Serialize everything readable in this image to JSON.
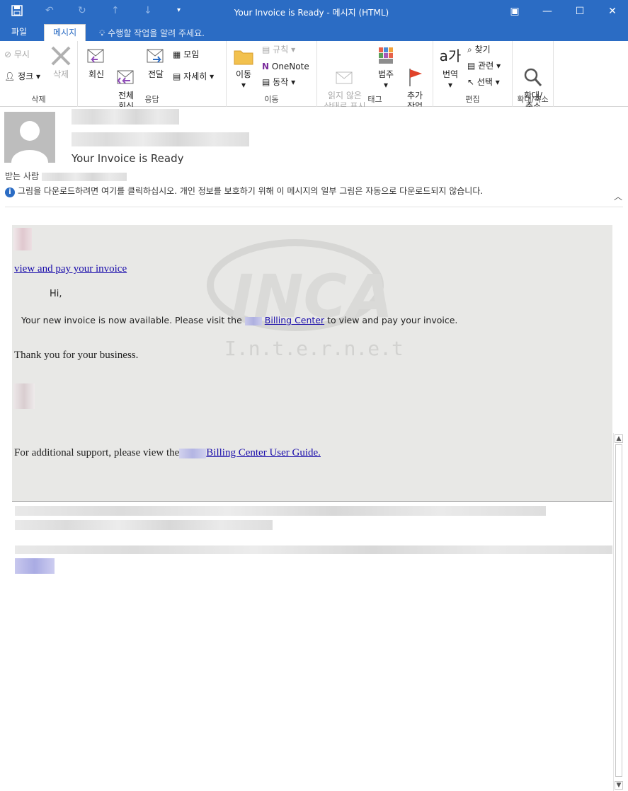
{
  "window": {
    "title": "Your Invoice is Ready - 메시지 (HTML)",
    "quick_access": [
      "save-icon",
      "undo-icon",
      "redo-icon",
      "up-icon",
      "down-icon",
      "customize-icon"
    ]
  },
  "tabs": [
    {
      "label": "파일"
    },
    {
      "label": "메시지"
    }
  ],
  "tell_me": "수행할 작업을 알려 주세요.",
  "ribbon": {
    "delete_group": {
      "label": "삭제",
      "ignore": "무시",
      "junk": "정크",
      "delete": "삭제"
    },
    "respond_group": {
      "label": "응답",
      "reply": "회신",
      "reply_all": "전체\n회신",
      "forward": "전달",
      "meeting": "모임",
      "more": "자세히"
    },
    "move_group": {
      "label": "이동",
      "move": "이동",
      "rules": "규칙",
      "onenote": "OneNote",
      "actions": "동작"
    },
    "tags_group": {
      "label": "태그",
      "unread": "읽지 않은\n상태로 표시",
      "categorize": "범주",
      "followup": "추가\n작업"
    },
    "edit_group": {
      "label": "편집",
      "translate": "번역",
      "find": "찾기",
      "related": "관련",
      "select": "선택"
    },
    "zoom_group": {
      "label": "확대/축소",
      "zoom": "확대/\n축소"
    }
  },
  "header": {
    "subject": "Your Invoice is Ready",
    "to_label": "받는 사람",
    "info_bar": "그림을 다운로드하려면 여기를 클릭하십시오. 개인 정보를 보호하기 위해 이 메시지의 일부 그림은 자동으로 다운로드되지 않습니다."
  },
  "email": {
    "view_link": "view and pay your invoice",
    "greeting": "Hi,",
    "body_prefix": "Your new invoice is now available. Please visit the",
    "billing_center": "Billing Center",
    "body_suffix": "to view and pay your invoice.",
    "thanks": "Thank you for your business.",
    "support_prefix": "For additional support, please view the",
    "support_link": "Billing Center User Guide.",
    "watermark_title": "INCA",
    "watermark_sub": "I.n.t.e.r.n.e.t"
  },
  "colors": {
    "accent": "#2b6cc4",
    "message_bg": "#e8e8e6",
    "link": "#1a0dab"
  }
}
